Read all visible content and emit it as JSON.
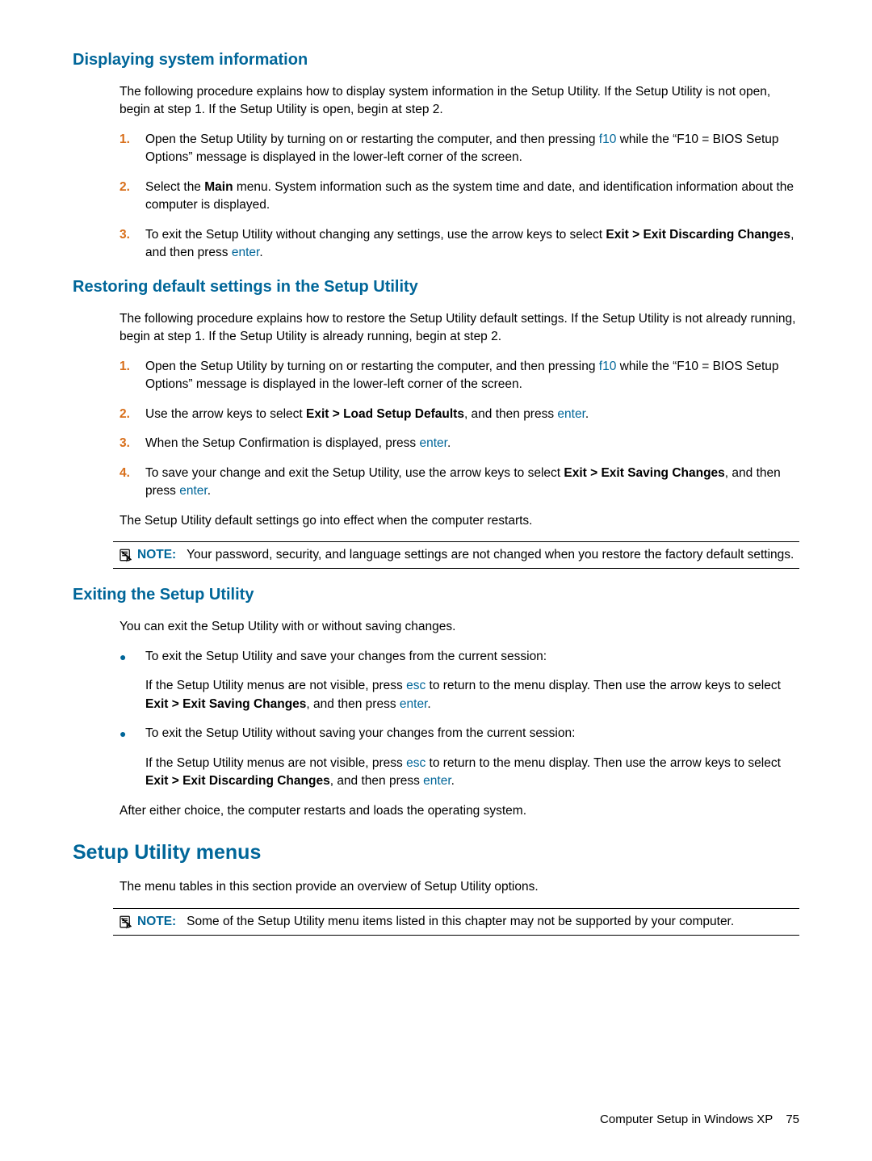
{
  "s1": {
    "title": "Displaying system information",
    "intro": "The following procedure explains how to display system information in the Setup Utility. If the Setup Utility is not open, begin at step 1. If the Setup Utility is open, begin at step 2.",
    "li1_num": "1.",
    "li1_a": "Open the Setup Utility by turning on or restarting the computer, and then pressing ",
    "li1_key": "f10",
    "li1_b": " while the “F10 = BIOS Setup Options” message is displayed in the lower-left corner of the screen.",
    "li2_num": "2.",
    "li2_a": "Select the ",
    "li2_bold": "Main",
    "li2_b": " menu. System information such as the system time and date, and identification information about the computer is displayed.",
    "li3_num": "3.",
    "li3_a": "To exit the Setup Utility without changing any settings, use the arrow keys to select ",
    "li3_bold": "Exit > Exit Discarding Changes",
    "li3_b": ", and then press ",
    "li3_key": "enter",
    "li3_c": "."
  },
  "s2": {
    "title": "Restoring default settings in the Setup Utility",
    "intro": "The following procedure explains how to restore the Setup Utility default settings. If the Setup Utility is not already running, begin at step 1. If the Setup Utility is already running, begin at step 2.",
    "li1_num": "1.",
    "li1_a": "Open the Setup Utility by turning on or restarting the computer, and then pressing ",
    "li1_key": "f10",
    "li1_b": " while the “F10 = BIOS Setup Options” message is displayed in the lower-left corner of the screen.",
    "li2_num": "2.",
    "li2_a": "Use the arrow keys to select ",
    "li2_bold": "Exit > Load Setup Defaults",
    "li2_b": ", and then press ",
    "li2_key": "enter",
    "li2_c": ".",
    "li3_num": "3.",
    "li3_a": "When the Setup Confirmation is displayed, press ",
    "li3_key": "enter",
    "li3_b": ".",
    "li4_num": "4.",
    "li4_a": "To save your change and exit the Setup Utility, use the arrow keys to select ",
    "li4_bold": "Exit > Exit Saving Changes",
    "li4_b": ", and then press ",
    "li4_key": "enter",
    "li4_c": ".",
    "outro": "The Setup Utility default settings go into effect when the computer restarts.",
    "note_label": "NOTE:",
    "note_text": "Your password, security, and language settings are not changed when you restore the factory default settings."
  },
  "s3": {
    "title": "Exiting the Setup Utility",
    "intro": "You can exit the Setup Utility with or without saving changes.",
    "b1": "To exit the Setup Utility and save your changes from the current session:",
    "b1sub_a": "If the Setup Utility menus are not visible, press ",
    "b1sub_key1": "esc",
    "b1sub_b": " to return to the menu display. Then use the arrow keys to select ",
    "b1sub_bold": "Exit > Exit Saving Changes",
    "b1sub_c": ", and then press ",
    "b1sub_key2": "enter",
    "b1sub_d": ".",
    "b2": "To exit the Setup Utility without saving your changes from the current session:",
    "b2sub_a": "If the Setup Utility menus are not visible, press ",
    "b2sub_key1": "esc",
    "b2sub_b": " to return to the menu display. Then use the arrow keys to select ",
    "b2sub_bold": "Exit > Exit Discarding Changes",
    "b2sub_c": ", and then press ",
    "b2sub_key2": "enter",
    "b2sub_d": ".",
    "outro": "After either choice, the computer restarts and loads the operating system."
  },
  "s4": {
    "title": "Setup Utility menus",
    "intro": "The menu tables in this section provide an overview of Setup Utility options.",
    "note_label": "NOTE:",
    "note_text": "Some of the Setup Utility menu items listed in this chapter may not be supported by your computer."
  },
  "footer": {
    "text": "Computer Setup in Windows XP",
    "page": "75"
  },
  "bullet": "●"
}
